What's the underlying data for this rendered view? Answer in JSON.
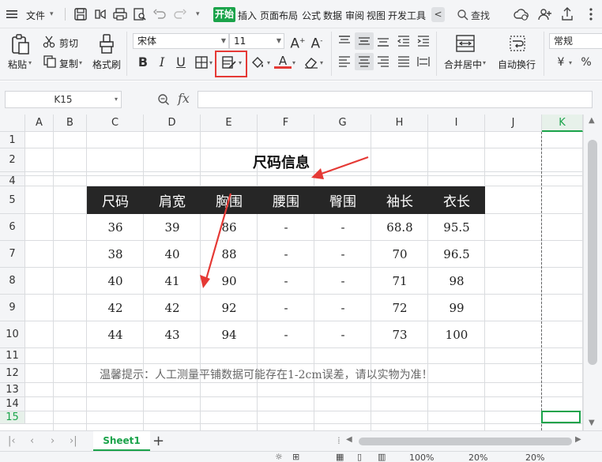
{
  "menubar": {
    "file_label": "文件",
    "tabs": [
      "开始",
      "插入",
      "页面布局",
      "公式",
      "数据",
      "审阅",
      "视图",
      "开发工具"
    ],
    "scroll_label": "<",
    "search_label": "查找"
  },
  "ribbon": {
    "paste_label": "粘贴",
    "cut_label": "剪切",
    "copy_label": "复制",
    "format_painter_label": "格式刷",
    "font_name": "宋体",
    "font_size": "11",
    "bold_label": "B",
    "italic_label": "I",
    "underline_label": "U",
    "font_color_label": "A",
    "merge_label": "合并居中",
    "wrap_label": "自动换行",
    "number_format": "常规",
    "currency_label": "¥",
    "percent_label": "%"
  },
  "formula_bar": {
    "cell_ref": "K15",
    "fx_label": "fx",
    "formula": ""
  },
  "grid": {
    "columns": [
      "A",
      "B",
      "C",
      "D",
      "E",
      "F",
      "G",
      "H",
      "I",
      "J",
      "K"
    ],
    "rows": [
      "1",
      "2",
      "3",
      "4",
      "5",
      "6",
      "7",
      "8",
      "9",
      "10",
      "11",
      "12",
      "13",
      "14",
      "15"
    ],
    "selected_col": "K",
    "selected_row": "15"
  },
  "sheet": {
    "title": "尺码信息",
    "headers": [
      "尺码",
      "肩宽",
      "胸围",
      "腰围",
      "臀围",
      "袖长",
      "衣长"
    ],
    "rows": [
      [
        "36",
        "39",
        "86",
        "-",
        "-",
        "68.8",
        "95.5"
      ],
      [
        "38",
        "40",
        "88",
        "-",
        "-",
        "70",
        "96.5"
      ],
      [
        "40",
        "41",
        "90",
        "-",
        "-",
        "71",
        "98"
      ],
      [
        "42",
        "42",
        "92",
        "-",
        "-",
        "72",
        "99"
      ],
      [
        "44",
        "43",
        "94",
        "-",
        "-",
        "73",
        "100"
      ]
    ],
    "note": "温馨提示：人工测量平铺数据可能存在1-2cm误差，请以实物为准！",
    "header_bg": "#262626"
  },
  "sheet_tabs": {
    "active": "Sheet1",
    "add_label": "+"
  },
  "statusbar": {
    "zoom_left": "100%",
    "zoom_mid": "20%",
    "zoom_right": "20%"
  },
  "colors": {
    "accent": "#1aa34a",
    "highlight": "#e53935"
  }
}
